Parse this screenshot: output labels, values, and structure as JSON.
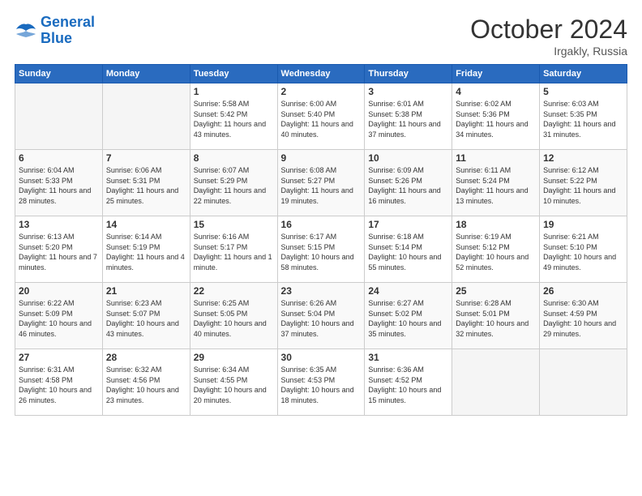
{
  "logo": {
    "line1": "General",
    "line2": "Blue"
  },
  "title": "October 2024",
  "subtitle": "Irgakly, Russia",
  "weekdays": [
    "Sunday",
    "Monday",
    "Tuesday",
    "Wednesday",
    "Thursday",
    "Friday",
    "Saturday"
  ],
  "weeks": [
    [
      {
        "day": "",
        "empty": true
      },
      {
        "day": "",
        "empty": true
      },
      {
        "day": "1",
        "sunrise": "5:58 AM",
        "sunset": "5:42 PM",
        "daylight": "11 hours and 43 minutes."
      },
      {
        "day": "2",
        "sunrise": "6:00 AM",
        "sunset": "5:40 PM",
        "daylight": "11 hours and 40 minutes."
      },
      {
        "day": "3",
        "sunrise": "6:01 AM",
        "sunset": "5:38 PM",
        "daylight": "11 hours and 37 minutes."
      },
      {
        "day": "4",
        "sunrise": "6:02 AM",
        "sunset": "5:36 PM",
        "daylight": "11 hours and 34 minutes."
      },
      {
        "day": "5",
        "sunrise": "6:03 AM",
        "sunset": "5:35 PM",
        "daylight": "11 hours and 31 minutes."
      }
    ],
    [
      {
        "day": "6",
        "sunrise": "6:04 AM",
        "sunset": "5:33 PM",
        "daylight": "11 hours and 28 minutes."
      },
      {
        "day": "7",
        "sunrise": "6:06 AM",
        "sunset": "5:31 PM",
        "daylight": "11 hours and 25 minutes."
      },
      {
        "day": "8",
        "sunrise": "6:07 AM",
        "sunset": "5:29 PM",
        "daylight": "11 hours and 22 minutes."
      },
      {
        "day": "9",
        "sunrise": "6:08 AM",
        "sunset": "5:27 PM",
        "daylight": "11 hours and 19 minutes."
      },
      {
        "day": "10",
        "sunrise": "6:09 AM",
        "sunset": "5:26 PM",
        "daylight": "11 hours and 16 minutes."
      },
      {
        "day": "11",
        "sunrise": "6:11 AM",
        "sunset": "5:24 PM",
        "daylight": "11 hours and 13 minutes."
      },
      {
        "day": "12",
        "sunrise": "6:12 AM",
        "sunset": "5:22 PM",
        "daylight": "11 hours and 10 minutes."
      }
    ],
    [
      {
        "day": "13",
        "sunrise": "6:13 AM",
        "sunset": "5:20 PM",
        "daylight": "11 hours and 7 minutes."
      },
      {
        "day": "14",
        "sunrise": "6:14 AM",
        "sunset": "5:19 PM",
        "daylight": "11 hours and 4 minutes."
      },
      {
        "day": "15",
        "sunrise": "6:16 AM",
        "sunset": "5:17 PM",
        "daylight": "11 hours and 1 minute."
      },
      {
        "day": "16",
        "sunrise": "6:17 AM",
        "sunset": "5:15 PM",
        "daylight": "10 hours and 58 minutes."
      },
      {
        "day": "17",
        "sunrise": "6:18 AM",
        "sunset": "5:14 PM",
        "daylight": "10 hours and 55 minutes."
      },
      {
        "day": "18",
        "sunrise": "6:19 AM",
        "sunset": "5:12 PM",
        "daylight": "10 hours and 52 minutes."
      },
      {
        "day": "19",
        "sunrise": "6:21 AM",
        "sunset": "5:10 PM",
        "daylight": "10 hours and 49 minutes."
      }
    ],
    [
      {
        "day": "20",
        "sunrise": "6:22 AM",
        "sunset": "5:09 PM",
        "daylight": "10 hours and 46 minutes."
      },
      {
        "day": "21",
        "sunrise": "6:23 AM",
        "sunset": "5:07 PM",
        "daylight": "10 hours and 43 minutes."
      },
      {
        "day": "22",
        "sunrise": "6:25 AM",
        "sunset": "5:05 PM",
        "daylight": "10 hours and 40 minutes."
      },
      {
        "day": "23",
        "sunrise": "6:26 AM",
        "sunset": "5:04 PM",
        "daylight": "10 hours and 37 minutes."
      },
      {
        "day": "24",
        "sunrise": "6:27 AM",
        "sunset": "5:02 PM",
        "daylight": "10 hours and 35 minutes."
      },
      {
        "day": "25",
        "sunrise": "6:28 AM",
        "sunset": "5:01 PM",
        "daylight": "10 hours and 32 minutes."
      },
      {
        "day": "26",
        "sunrise": "6:30 AM",
        "sunset": "4:59 PM",
        "daylight": "10 hours and 29 minutes."
      }
    ],
    [
      {
        "day": "27",
        "sunrise": "6:31 AM",
        "sunset": "4:58 PM",
        "daylight": "10 hours and 26 minutes."
      },
      {
        "day": "28",
        "sunrise": "6:32 AM",
        "sunset": "4:56 PM",
        "daylight": "10 hours and 23 minutes."
      },
      {
        "day": "29",
        "sunrise": "6:34 AM",
        "sunset": "4:55 PM",
        "daylight": "10 hours and 20 minutes."
      },
      {
        "day": "30",
        "sunrise": "6:35 AM",
        "sunset": "4:53 PM",
        "daylight": "10 hours and 18 minutes."
      },
      {
        "day": "31",
        "sunrise": "6:36 AM",
        "sunset": "4:52 PM",
        "daylight": "10 hours and 15 minutes."
      },
      {
        "day": "",
        "empty": true
      },
      {
        "day": "",
        "empty": true
      }
    ]
  ]
}
